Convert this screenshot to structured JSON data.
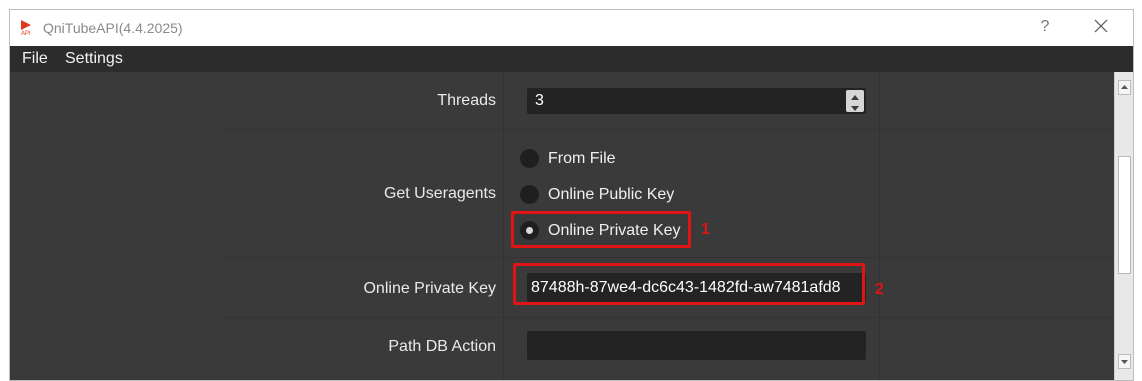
{
  "window": {
    "title": "QniTubeAPI(4.4.2025)",
    "help_label": "?"
  },
  "menu": {
    "items": [
      "File",
      "Settings"
    ]
  },
  "form": {
    "threads": {
      "label": "Threads",
      "value": "3"
    },
    "useragents": {
      "label": "Get Useragents",
      "options": [
        "From File",
        "Online Public Key",
        "Online Private Key"
      ],
      "selected": "Online Private Key"
    },
    "private_key": {
      "label": "Online Private Key",
      "value": "87488h-87we4-dc6c43-1482fd-aw7481afd8"
    },
    "path_db": {
      "label": "Path DB Action",
      "value": ""
    }
  },
  "annotations": [
    {
      "number": "1",
      "target": "Online Private Key radio"
    },
    {
      "number": "2",
      "target": "Online Private Key field"
    }
  ],
  "colors": {
    "background": "#3a3a3a",
    "menubar": "#2c2c2c",
    "input": "#232323",
    "highlight": "#e01414"
  }
}
